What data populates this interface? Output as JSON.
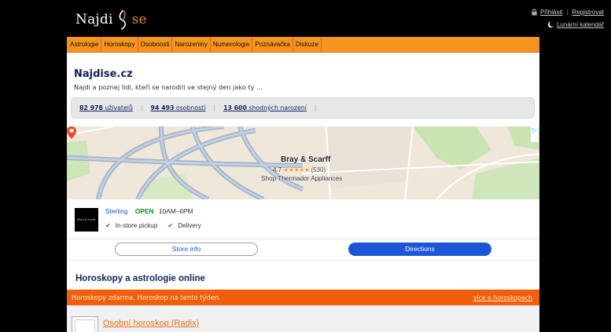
{
  "header": {
    "logo_left": "Najdi",
    "logo_right": "se",
    "login_label": "Přihlásit",
    "register_label": "Registrovat",
    "lunar_calendar_label": "Lunární kalendář"
  },
  "nav": {
    "items": [
      "Astrologie",
      "Horoskopy",
      "Osobnosti",
      "Narozeniny",
      "Numerologie",
      "Poznávačka",
      "Diskuze"
    ]
  },
  "intro": {
    "title": "Najdise.cz",
    "tagline": "Najdi a poznej lidi, kteří se narodili ve stejný den jako ty ..."
  },
  "stats": {
    "users_count": "82 978",
    "users_label": "uživatelů",
    "persons_count": "94 493",
    "persons_label": "osobností",
    "matches_count": "13 600",
    "matches_label": "shodných narození"
  },
  "ad": {
    "business_name": "Bray & Scarff",
    "rating": "4.7",
    "stars": "★★★★★",
    "review_count": "(530)",
    "subtitle": "Shop Thermador Appliances",
    "logo_text": "Bray & Scarff",
    "town": "Sterling",
    "status": "OPEN",
    "hours": "10AM–6PM",
    "feature_1": "In-store pickup",
    "feature_2": "Delivery",
    "store_info_label": "Store info",
    "directions_label": "Directions",
    "adchoices_glyph": "▷"
  },
  "section": {
    "title": "Horoskopy a astrologie online",
    "bar_text": "Horoskopy zdarma, Horoskop na tento týden",
    "bar_link": "více o horoskopech",
    "item_label": "Osobní horoskop (Radix)"
  },
  "colors": {
    "nav_orange": "#f7941d",
    "bar_orange": "#f25f0c",
    "title_navy": "#14225b",
    "link_blue": "#1a57c9",
    "open_green": "#0e8a2e",
    "directions_blue": "#1a56d6"
  }
}
